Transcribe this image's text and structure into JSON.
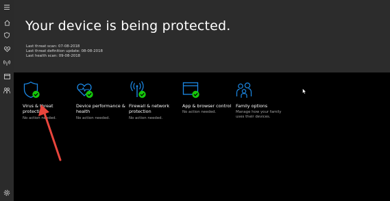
{
  "colors": {
    "accent": "#1c8ae8",
    "check": "#16c60c",
    "arrow": "#e8453c",
    "hero_bg": "#2c2c2c",
    "sidebar_bg": "#2b2b2b"
  },
  "sidebar": {
    "items": [
      {
        "icon": "hamburger-menu-icon"
      },
      {
        "icon": "home-icon"
      },
      {
        "icon": "shield-icon"
      },
      {
        "icon": "heart-icon"
      },
      {
        "icon": "wifi-antenna-icon"
      },
      {
        "icon": "browser-window-icon"
      },
      {
        "icon": "family-icon"
      },
      {
        "icon": "settings-gear-icon"
      }
    ]
  },
  "hero": {
    "title": "Your device is being protected.",
    "last_threat_scan": "Last threat scan: 07-08-2018",
    "last_definition_update": "Last threat definition update: 08-08-2018",
    "last_health_scan": "Last health scan: 09-08-2018"
  },
  "tiles": [
    {
      "icon": "virus-shield-icon",
      "label": "Virus & threat protection",
      "status": "No action needed."
    },
    {
      "icon": "device-health-heart-icon",
      "label": "Device performance & health",
      "status": "No action needed."
    },
    {
      "icon": "firewall-antenna-icon",
      "label": "Firewall & network protection",
      "status": "No action needed."
    },
    {
      "icon": "app-browser-window-icon",
      "label": "App & browser control",
      "status": "No action needed."
    },
    {
      "icon": "family-people-icon",
      "label": "Family options",
      "status": "Manage how your family uses their devices."
    }
  ]
}
